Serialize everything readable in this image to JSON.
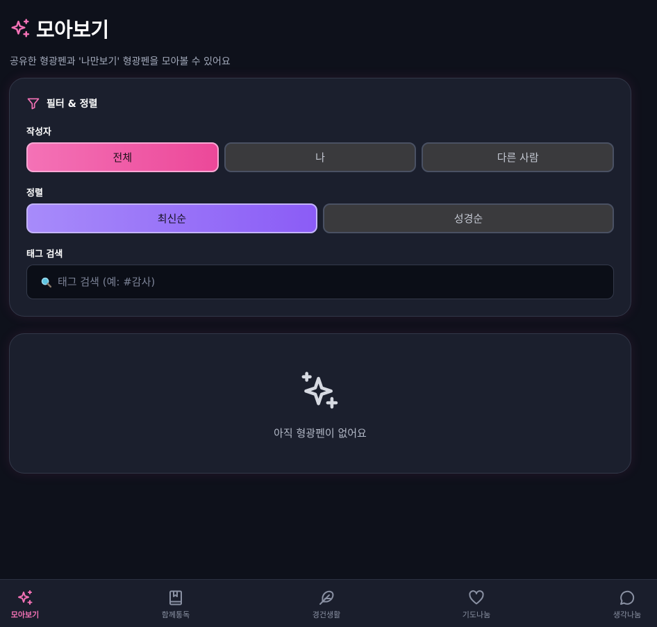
{
  "header": {
    "title": "모아보기",
    "subtitle": "공유한 형광펜과 '나만보기' 형광펜을 모아볼 수 있어요",
    "title_icon": "sparkles-icon"
  },
  "filter": {
    "title": "필터 & 정렬",
    "title_icon": "filter-icon",
    "author": {
      "label": "작성자",
      "options": [
        "전체",
        "나",
        "다른 사람"
      ],
      "selected": "전체"
    },
    "sort": {
      "label": "정렬",
      "options": [
        "최신순",
        "성경순"
      ],
      "selected": "최신순"
    },
    "tag_search": {
      "label": "태그 검색",
      "placeholder": "태그 검색 (예: #감사)",
      "value": "",
      "icon": "magnifier-icon"
    }
  },
  "empty_state": {
    "icon": "sparkles-icon",
    "message": "아직 형광펜이 없어요"
  },
  "bottom_nav": {
    "items": [
      {
        "label": "모아보기",
        "icon": "sparkles-icon",
        "active": true
      },
      {
        "label": "함께통독",
        "icon": "book-icon",
        "active": false
      },
      {
        "label": "경건생활",
        "icon": "feather-icon",
        "active": false
      },
      {
        "label": "기도나눔",
        "icon": "heart-icon",
        "active": false
      },
      {
        "label": "생각나눔",
        "icon": "chat-bubble-icon",
        "active": false
      }
    ]
  },
  "colors": {
    "background": "#0e111b",
    "card": "#1b1f2d",
    "accent_pink": "#ec4899",
    "accent_purple": "#8b5cf6",
    "muted_text": "#a3aabb"
  }
}
